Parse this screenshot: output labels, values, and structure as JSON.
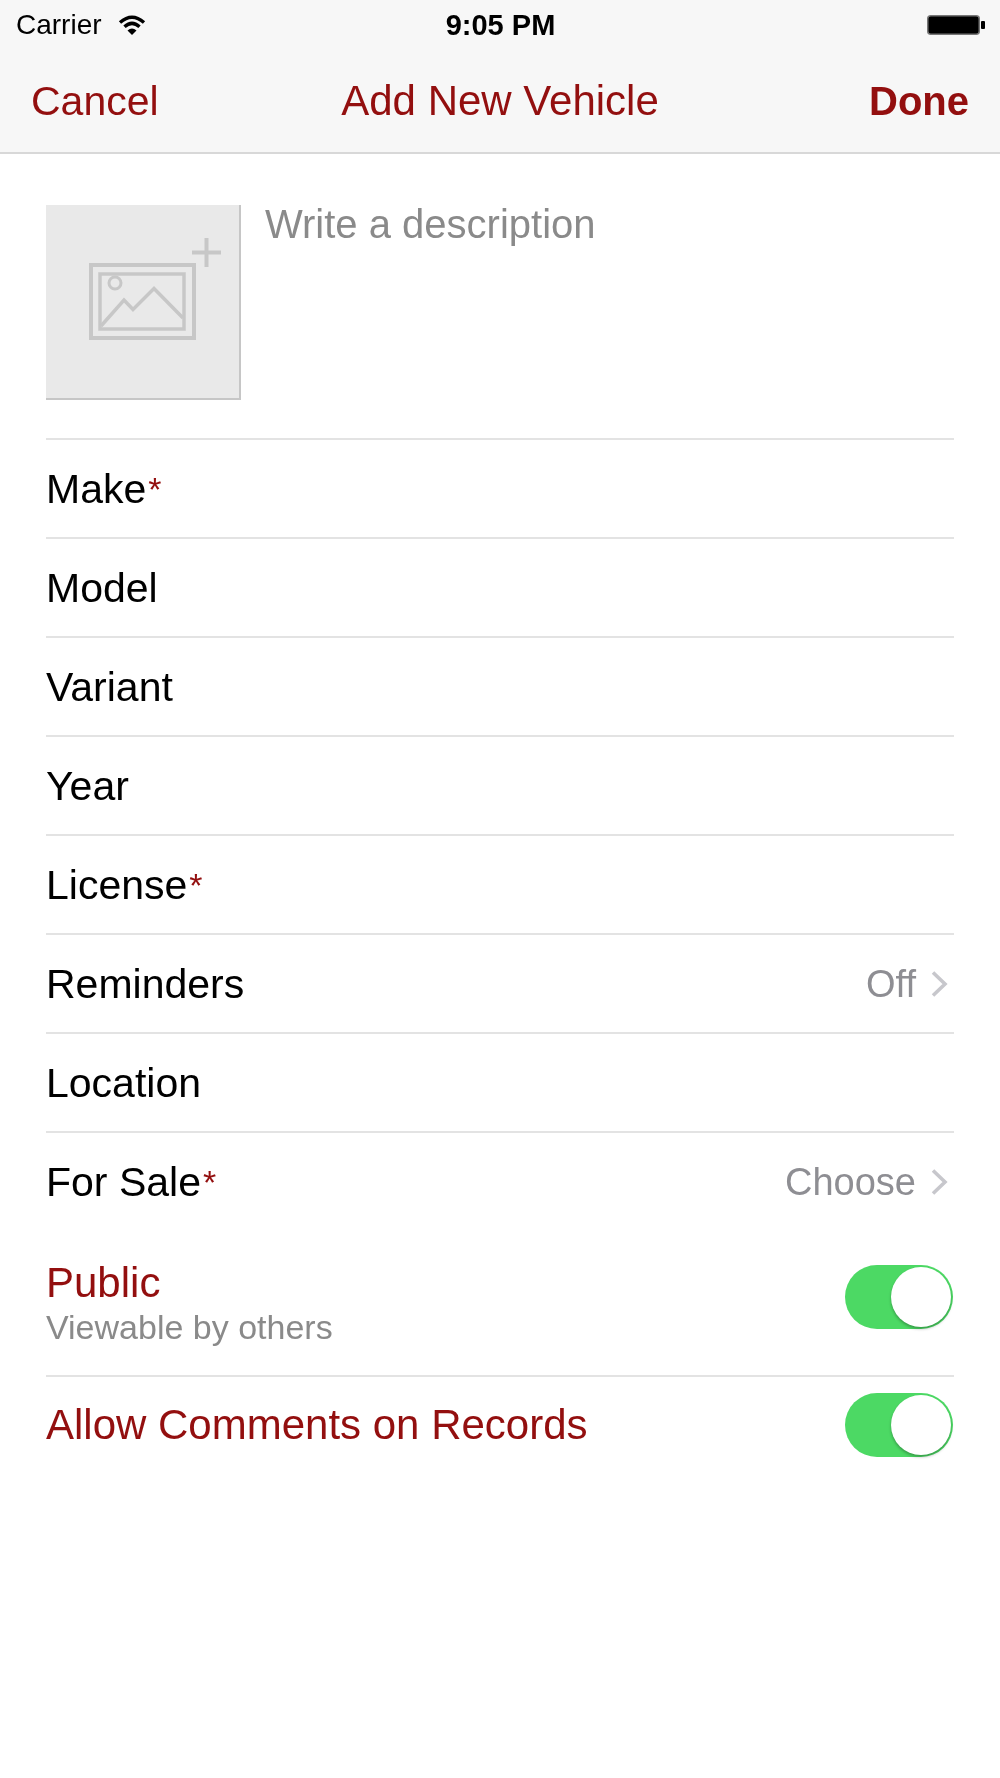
{
  "status_bar": {
    "carrier": "Carrier",
    "time": "9:05 PM"
  },
  "nav_bar": {
    "cancel": "Cancel",
    "title": "Add New Vehicle",
    "done": "Done"
  },
  "description": {
    "placeholder": "Write a description"
  },
  "fields": [
    {
      "kind": "text",
      "label": "Make",
      "required_mark": "*"
    },
    {
      "kind": "text",
      "label": "Model"
    },
    {
      "kind": "text",
      "label": "Variant"
    },
    {
      "kind": "text",
      "label": "Year"
    },
    {
      "kind": "text",
      "label": "License",
      "required_mark": "*"
    },
    {
      "kind": "disclosure",
      "label": "Reminders",
      "value": "Off"
    },
    {
      "kind": "text",
      "label": "Location"
    },
    {
      "kind": "disclosure",
      "label": "For Sale",
      "required_mark": "*",
      "value": "Choose"
    }
  ],
  "settings": [
    {
      "label": "Public",
      "subtitle": "Viewable by others",
      "on": true
    },
    {
      "label": "Allow Comments on Records",
      "on": true
    }
  ]
}
